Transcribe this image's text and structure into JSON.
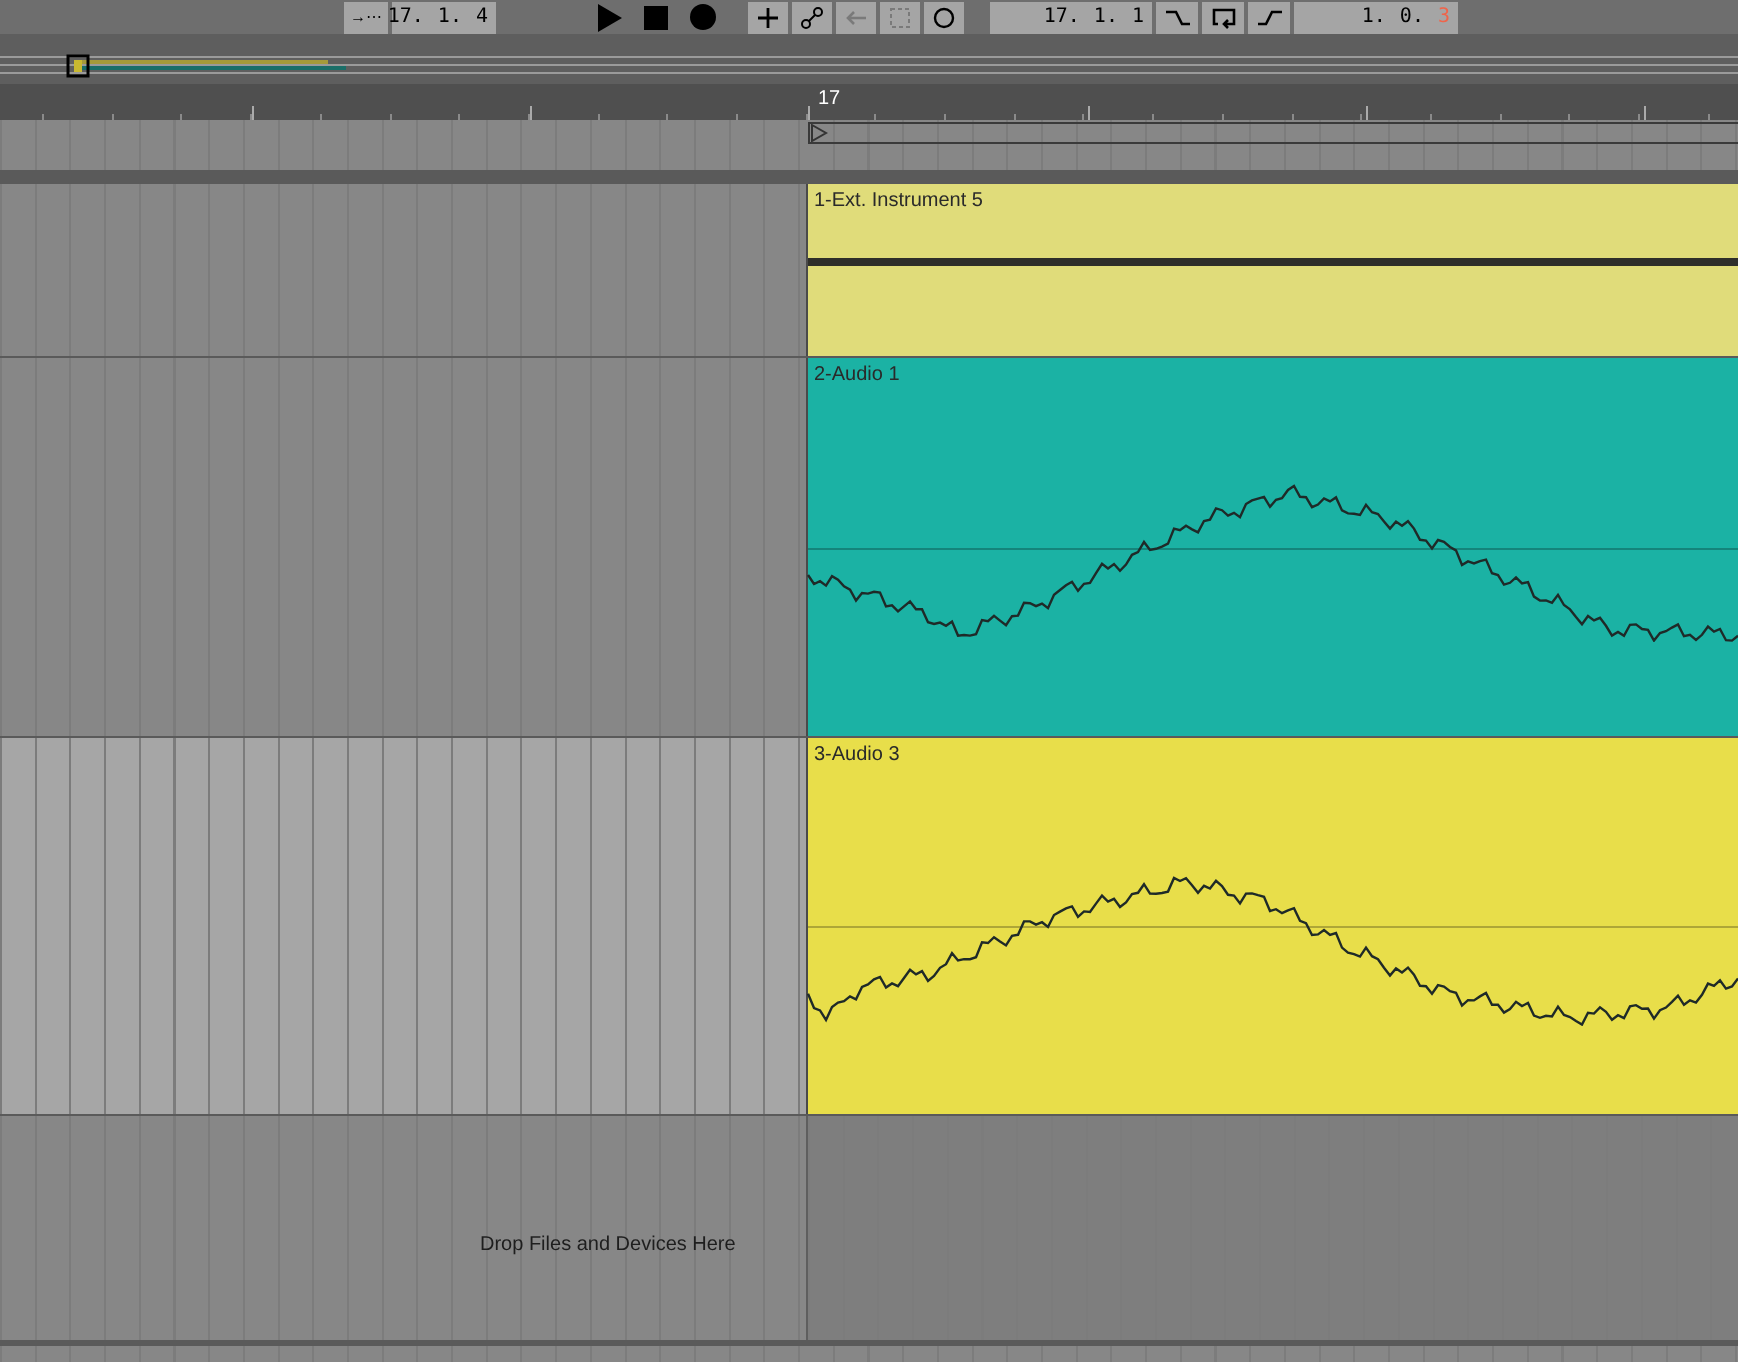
{
  "transport": {
    "follow_label": "→⋯",
    "position": [
      {
        "text": "17.",
        "highlight": false
      },
      {
        "text": "1.",
        "highlight": false
      },
      {
        "text": "4",
        "highlight": false
      }
    ],
    "tools": [
      {
        "kind": "add",
        "disabled": false
      },
      {
        "kind": "automation",
        "disabled": false
      },
      {
        "kind": "back",
        "disabled": true
      },
      {
        "kind": "capture",
        "disabled": true
      },
      {
        "kind": "circle",
        "disabled": false
      }
    ],
    "loop_start": [
      {
        "text": "17.",
        "highlight": false
      },
      {
        "text": "1.",
        "highlight": false
      },
      {
        "text": "1",
        "highlight": false
      }
    ],
    "loop_tools": [
      {
        "kind": "punch-in"
      },
      {
        "kind": "loop"
      },
      {
        "kind": "punch-out"
      }
    ],
    "loop_length": [
      {
        "text": "1.",
        "highlight": false
      },
      {
        "text": "0.",
        "highlight": false
      },
      {
        "text": "3",
        "highlight": true
      }
    ]
  },
  "ruler": {
    "bar_label": "17"
  },
  "tracks": [
    {
      "name": "1-Ext. Instrument 5",
      "kind": "midi",
      "color": "#e0dc7a",
      "selected": false
    },
    {
      "name": "2-Audio 1",
      "kind": "audio",
      "color": "#1bb2a4",
      "selected": false
    },
    {
      "name": "3-Audio 3",
      "kind": "audio",
      "color": "#e8de4a",
      "selected": true
    }
  ],
  "drop_area": {
    "hint": "Drop Files and Devices Here"
  }
}
